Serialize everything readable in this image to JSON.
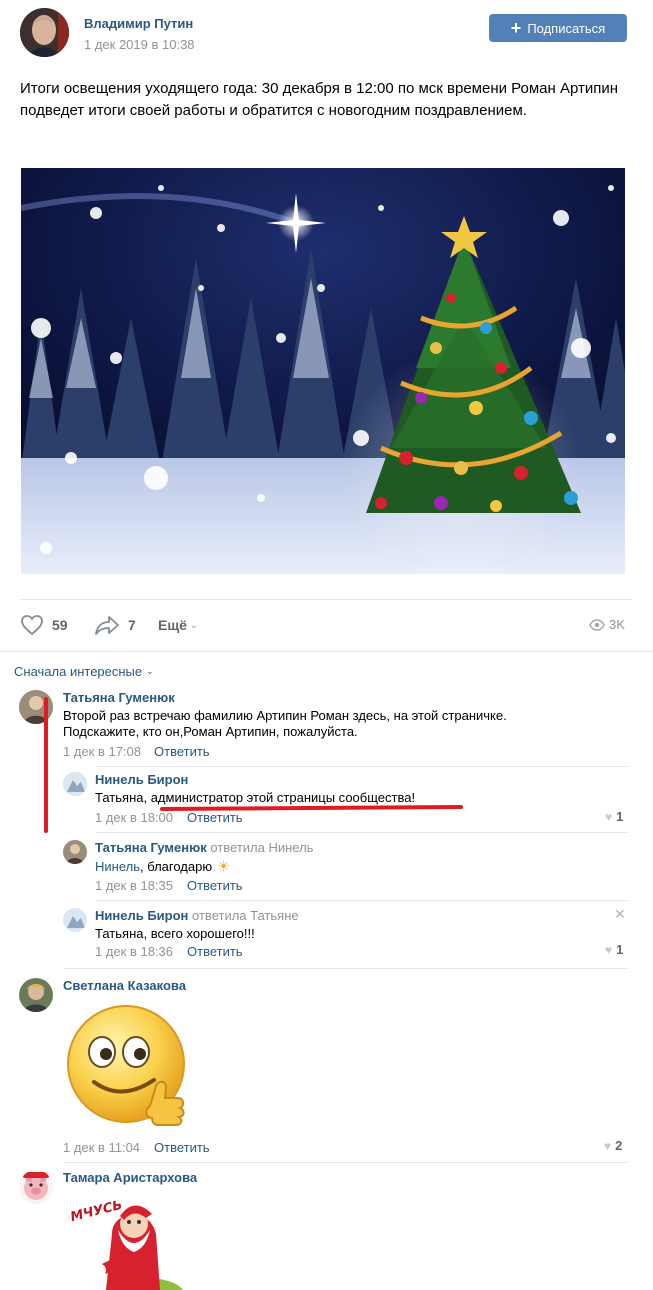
{
  "post": {
    "author": "Владимир Путин",
    "date": "1 дек 2019 в 10:38",
    "subscribe_label": "Подписаться",
    "text": "Итоги освещения уходящего года: 30 декабря в 12:00 по мск времени Роман Артипин подведет итоги своей работы и обратится с новогодним поздравлением.",
    "likes": "59",
    "shares": "7",
    "more_label": "Ещё",
    "views": "3K"
  },
  "comments": {
    "sort_label": "Сначала интересные",
    "reply_label": "Ответить",
    "items": [
      {
        "author": "Татьяна Гуменюк",
        "text": "Второй раз встречаю фамилию Артипин Роман здесь, на этой страничке. Подскажите, кто он,Роман Артипин, пожалуйста.",
        "date": "1 дек в 17:08"
      },
      {
        "author": "Нинель Бирон",
        "text": "Татьяна, администратор этой страницы сообщества!",
        "date": "1 дек в 18:00",
        "likes": "1"
      },
      {
        "author": "Татьяна Гуменюк",
        "replied": "ответила Нинель",
        "mention": "Нинель",
        "text": ", благодарю",
        "date": "1 дек в 18:35"
      },
      {
        "author": "Нинель Бирон",
        "replied": "ответила Татьяне",
        "text": "Татьяна, всего хорошего!!!",
        "date": "1 дек в 18:36",
        "likes": "1"
      },
      {
        "author": "Светлана Казакова",
        "date": "1 дек в 11:04",
        "likes": "2"
      },
      {
        "author": "Тамара Аристархова",
        "sticker_text": "МЧУСЬ"
      }
    ]
  }
}
